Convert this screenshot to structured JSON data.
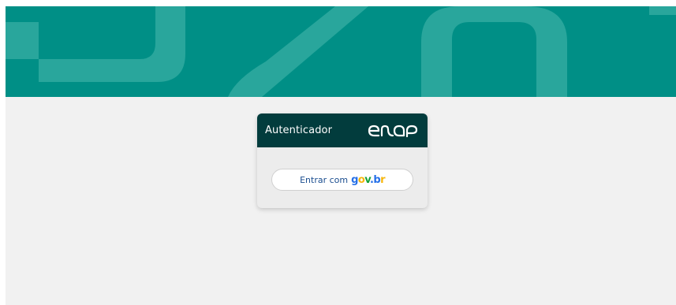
{
  "auth_card": {
    "title": "Autenticador",
    "brand_logo": "enap",
    "login_button": {
      "label": "Entrar com",
      "provider": "gov.br",
      "provider_letters": [
        "g",
        "o",
        "v",
        ".",
        "b",
        "r"
      ]
    }
  },
  "colors": {
    "banner": "#008f86",
    "banner_shapes": "#29a69c",
    "card_header": "#023c3d",
    "page_bg": "#f1f1f1",
    "button_text": "#1a4d8f"
  },
  "icons": [
    "enap-logo-icon",
    "govbr-logo-icon"
  ]
}
